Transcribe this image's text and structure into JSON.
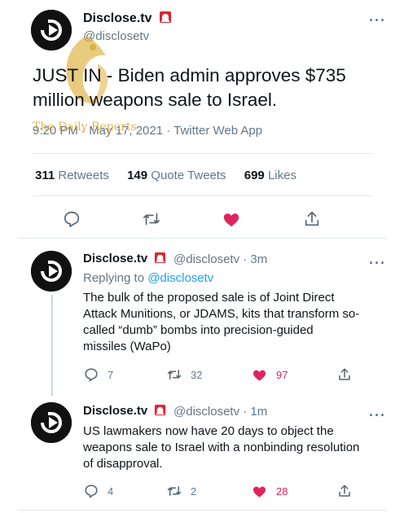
{
  "main_tweet": {
    "display_name": "Disclose.tv",
    "handle": "@disclosetv",
    "text": "JUST IN - Biden admin approves $735 million weapons sale to Israel.",
    "timestamp": "9:20 PM · May 17, 2021 · Twitter Web App",
    "more_icon": "ellipsis-icon",
    "stats": {
      "retweets_count": "311",
      "retweets_label": "Retweets",
      "quotes_count": "149",
      "quotes_label": "Quote Tweets",
      "likes_count": "699",
      "likes_label": "Likes"
    },
    "actions": [
      "reply-icon",
      "retweet-icon",
      "like-icon-filled",
      "share-icon"
    ]
  },
  "watermark": {
    "text": "The Daily Reports",
    "color": "#d6a014"
  },
  "replies": [
    {
      "display_name": "Disclose.tv",
      "handle": "@disclosetv",
      "time": "· 3m",
      "replying_prefix": "Replying to",
      "replying_to": "@disclosetv",
      "text": "The bulk of the proposed sale is of Joint Direct Attack Munitions, or JDAMS, kits that transform so-called “dumb” bombs into precision-guided missiles (WaPo)",
      "reply_count": "7",
      "retweet_count": "32",
      "like_count": "97"
    },
    {
      "display_name": "Disclose.tv",
      "handle": "@disclosetv",
      "time": "· 1m",
      "text": "US lawmakers now have 20 days to object the weapons sale to Israel with a nonbinding resolution of disapproval.",
      "reply_count": "4",
      "retweet_count": "2",
      "like_count": "28"
    }
  ],
  "colors": {
    "like_red": "#e0245e",
    "link_blue": "#1da1f2",
    "muted_gray": "#657786",
    "siren_red": "#e0242e"
  }
}
